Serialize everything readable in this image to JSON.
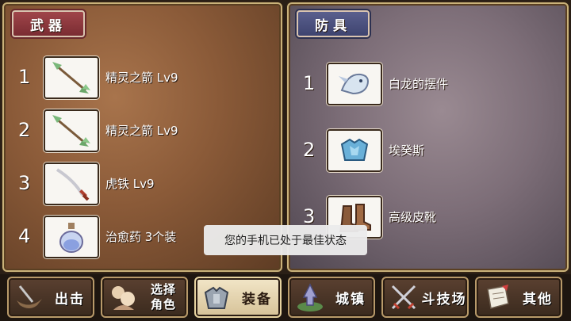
{
  "weapon_panel": {
    "title": "武器",
    "items": [
      {
        "num": "1",
        "icon": "arrow-icon",
        "name": "精灵之箭 Lv9"
      },
      {
        "num": "2",
        "icon": "arrow-icon",
        "name": "精灵之箭 Lv9"
      },
      {
        "num": "3",
        "icon": "saber-icon",
        "name": "虎铁 Lv9"
      },
      {
        "num": "4",
        "icon": "potion-icon",
        "name": "治愈药 3个装"
      }
    ]
  },
  "armor_panel": {
    "title": "防具",
    "items": [
      {
        "num": "1",
        "icon": "dragon-ornament-icon",
        "name": "白龙的摆件"
      },
      {
        "num": "2",
        "icon": "blue-armor-icon",
        "name": "埃癸斯"
      },
      {
        "num": "3",
        "icon": "boots-icon",
        "name": "高级皮靴"
      }
    ]
  },
  "toast": {
    "text": "您的手机已处于最佳状态"
  },
  "navbar": {
    "buttons": [
      {
        "label": "出击",
        "icon": "ship-icon"
      },
      {
        "label_line1": "选择",
        "label_line2": "角色",
        "icon": "characters-icon"
      },
      {
        "label": "装备",
        "icon": "armor-icon",
        "active": true
      },
      {
        "label": "城镇",
        "icon": "town-icon"
      },
      {
        "label": "斗技场",
        "icon": "crossed-swords-icon"
      },
      {
        "label": "其他",
        "icon": "scroll-icon"
      }
    ]
  },
  "colors": {
    "weapon_title_bg": "#8a3338",
    "armor_title_bg": "#4a5080",
    "active_nav_bg": "#e6d6b0"
  }
}
